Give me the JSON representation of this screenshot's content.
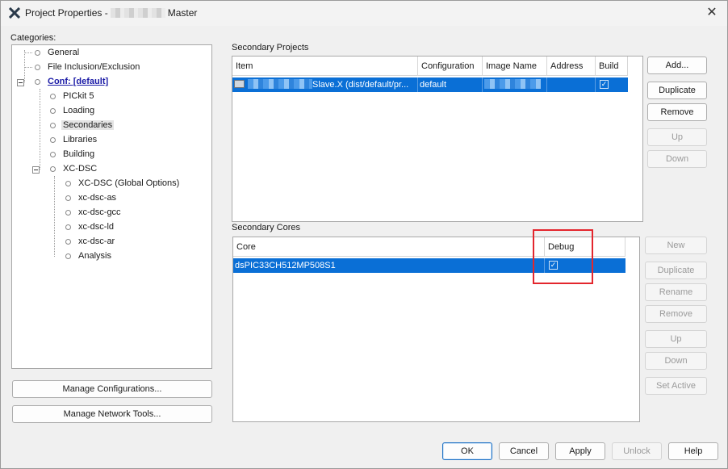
{
  "window": {
    "title_prefix": "Project Properties -",
    "title_suffix": "Master",
    "close_glyph": "✕"
  },
  "categories": {
    "label": "Categories:",
    "items": [
      {
        "label": "General"
      },
      {
        "label": "File Inclusion/Exclusion"
      },
      {
        "label": "Conf: [default]"
      },
      {
        "label": "PICkit 5"
      },
      {
        "label": "Loading"
      },
      {
        "label": "Secondaries"
      },
      {
        "label": "Libraries"
      },
      {
        "label": "Building"
      },
      {
        "label": "XC-DSC"
      },
      {
        "label": "XC-DSC (Global Options)"
      },
      {
        "label": "xc-dsc-as"
      },
      {
        "label": "xc-dsc-gcc"
      },
      {
        "label": "xc-dsc-ld"
      },
      {
        "label": "xc-dsc-ar"
      },
      {
        "label": "Analysis"
      }
    ],
    "selected": "Secondaries"
  },
  "left_buttons": {
    "manage_configurations": "Manage Configurations...",
    "manage_network_tools": "Manage Network Tools..."
  },
  "secondary_projects": {
    "label": "Secondary Projects",
    "columns": [
      "Item",
      "Configuration",
      "Image Name",
      "Address",
      "Build"
    ],
    "rows": [
      {
        "item": "Slave.X (dist/default/pr...",
        "configuration": "default",
        "image_name": "",
        "address": "",
        "build": true
      }
    ],
    "buttons": {
      "add": "Add...",
      "duplicate": "Duplicate",
      "remove": "Remove",
      "up": "Up",
      "down": "Down"
    }
  },
  "secondary_cores": {
    "label": "Secondary Cores",
    "columns": [
      "Core",
      "Debug"
    ],
    "rows": [
      {
        "core": "dsPIC33CH512MP508S1",
        "debug": true
      }
    ],
    "buttons": {
      "new": "New",
      "duplicate": "Duplicate",
      "rename": "Rename",
      "remove": "Remove",
      "up": "Up",
      "down": "Down",
      "set_active": "Set Active"
    }
  },
  "footer": {
    "ok": "OK",
    "cancel": "Cancel",
    "apply": "Apply",
    "unlock": "Unlock",
    "help": "Help"
  },
  "colors": {
    "selection": "#0a6fd6",
    "highlight_box": "#e3262d",
    "link": "#1a1aa6"
  },
  "icons": {
    "app": "mplab-x-icon",
    "close": "close-icon",
    "checkbox": "checkmark-icon",
    "row_item": "project-chip-icon"
  }
}
